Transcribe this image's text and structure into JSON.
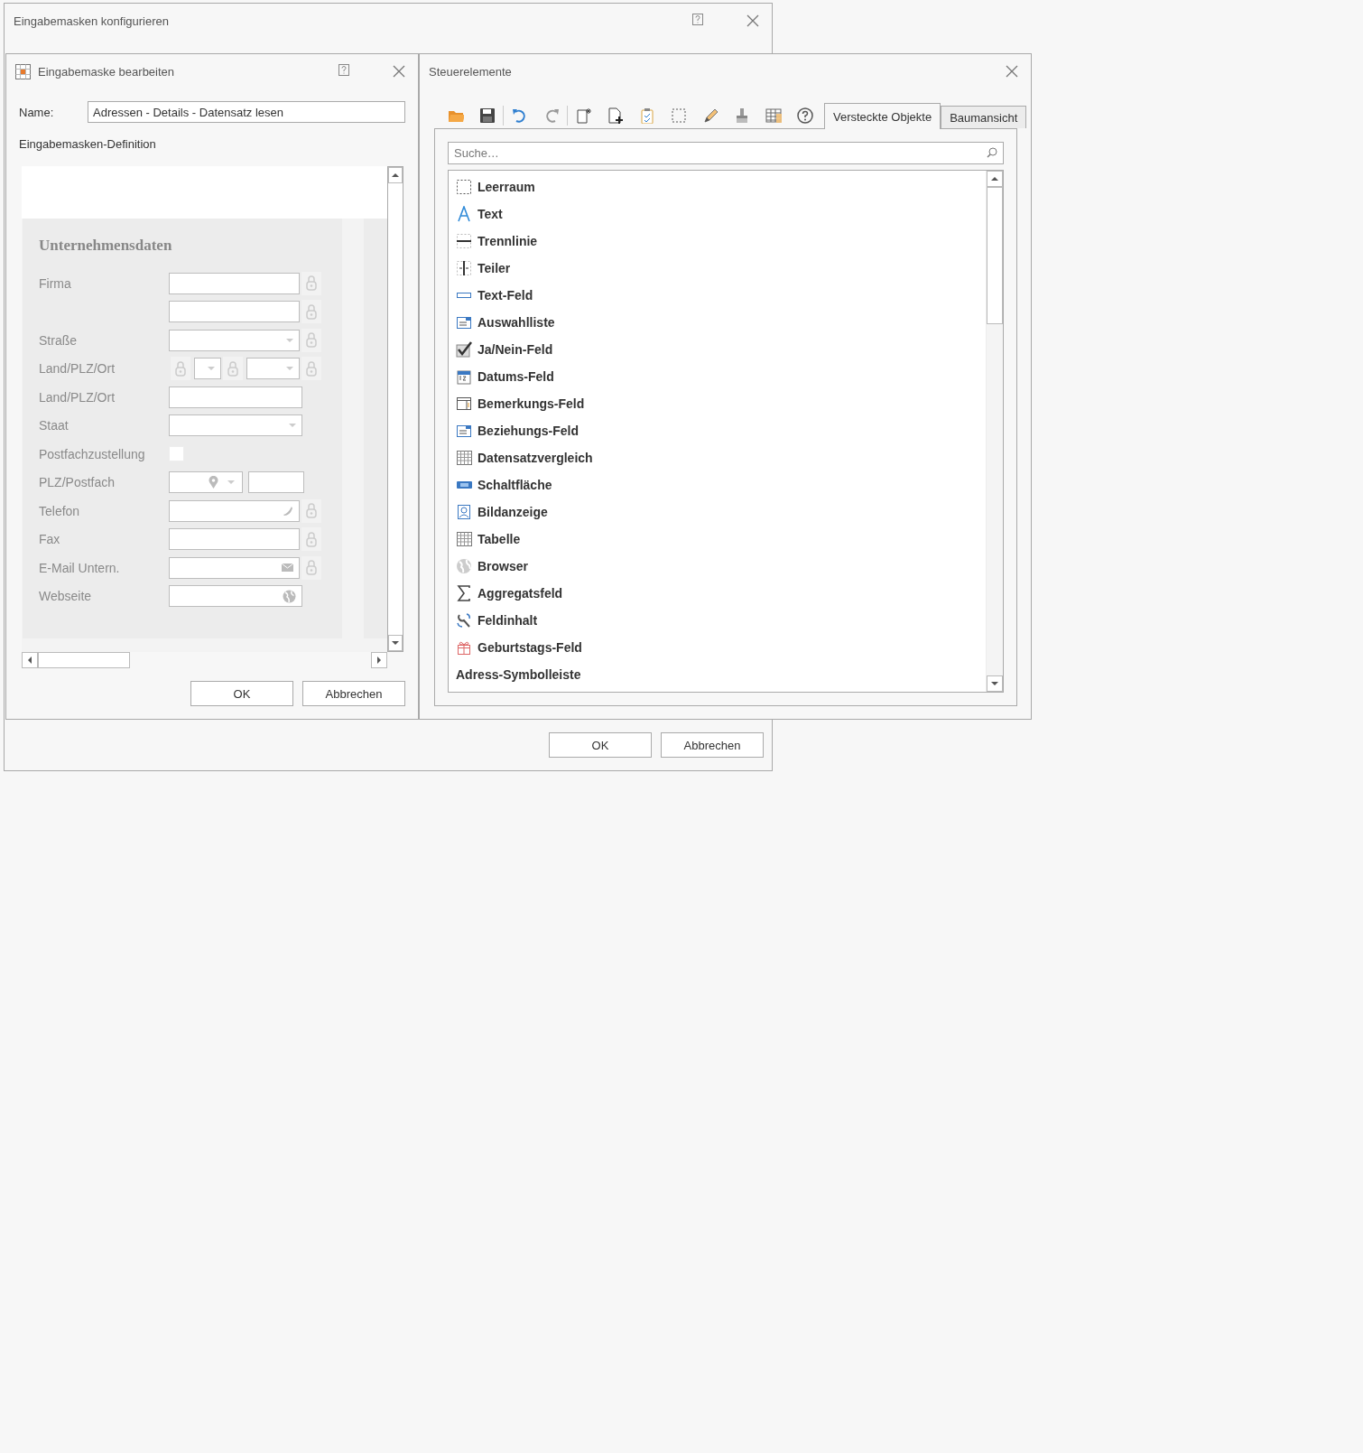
{
  "outer_window": {
    "title": "Eingabemasken konfigurieren",
    "buttons": [
      "OK",
      "Abbrechen"
    ]
  },
  "mask_editor": {
    "title": "Eingabemaske bearbeiten",
    "name_label": "Name:",
    "name_value": "Adressen - Details - Datensatz lesen",
    "definition_label": "Eingabemasken-Definition",
    "form": {
      "section_title": "Unternehmensdaten",
      "rows": [
        {
          "label": "Firma",
          "kind": "text",
          "lock": true
        },
        {
          "kind": "text",
          "lock": true
        },
        {
          "label": "Straße",
          "kind": "combo",
          "lock": true
        },
        {
          "label": "Land/PLZ/Ort",
          "kind": "triple",
          "lock": true
        },
        {
          "label": "Land/PLZ/Ort",
          "kind": "text",
          "lock": false
        },
        {
          "label": "Staat",
          "kind": "combo",
          "lock": false
        },
        {
          "label": "Postfachzustellung",
          "kind": "checkbox",
          "checked": false,
          "lock": false
        },
        {
          "label": "PLZ/Postfach",
          "kind": "postbox",
          "lock": false
        },
        {
          "label": "Telefon",
          "kind": "phone",
          "lock": true
        },
        {
          "label": "Fax",
          "kind": "text",
          "lock": true
        },
        {
          "label": "E-Mail Untern.",
          "kind": "mail",
          "lock": true
        },
        {
          "label": "Webseite",
          "kind": "web",
          "lock": false
        }
      ]
    },
    "buttons": [
      "OK",
      "Abbrechen"
    ]
  },
  "controls_window": {
    "title": "Steuerelemente",
    "tabs": [
      {
        "label": "Versteckte Objekte",
        "selected": true
      },
      {
        "label": "Baumansicht",
        "selected": false
      }
    ],
    "search": {
      "placeholder": "Suche…"
    },
    "items": [
      {
        "label": "Leerraum",
        "kind": "item"
      },
      {
        "label": "Text",
        "kind": "item"
      },
      {
        "label": "Trennlinie",
        "kind": "item"
      },
      {
        "label": "Teiler",
        "kind": "item"
      },
      {
        "label": "Text-Feld",
        "kind": "item"
      },
      {
        "label": "Auswahlliste",
        "kind": "item"
      },
      {
        "label": "Ja/Nein-Feld",
        "kind": "item"
      },
      {
        "label": "Datums-Feld",
        "kind": "item"
      },
      {
        "label": "Bemerkungs-Feld",
        "kind": "item"
      },
      {
        "label": "Beziehungs-Feld",
        "kind": "item"
      },
      {
        "label": "Datensatzvergleich",
        "kind": "item"
      },
      {
        "label": "Schaltfläche",
        "kind": "item"
      },
      {
        "label": "Bildanzeige",
        "kind": "item"
      },
      {
        "label": "Tabelle",
        "kind": "item"
      },
      {
        "label": "Browser",
        "kind": "item"
      },
      {
        "label": "Aggregatsfeld",
        "kind": "item"
      },
      {
        "label": "Feldinhalt",
        "kind": "item"
      },
      {
        "label": "Geburtstags-Feld",
        "kind": "item"
      },
      {
        "label": "Adress-Symbolleiste",
        "kind": "group"
      }
    ]
  }
}
